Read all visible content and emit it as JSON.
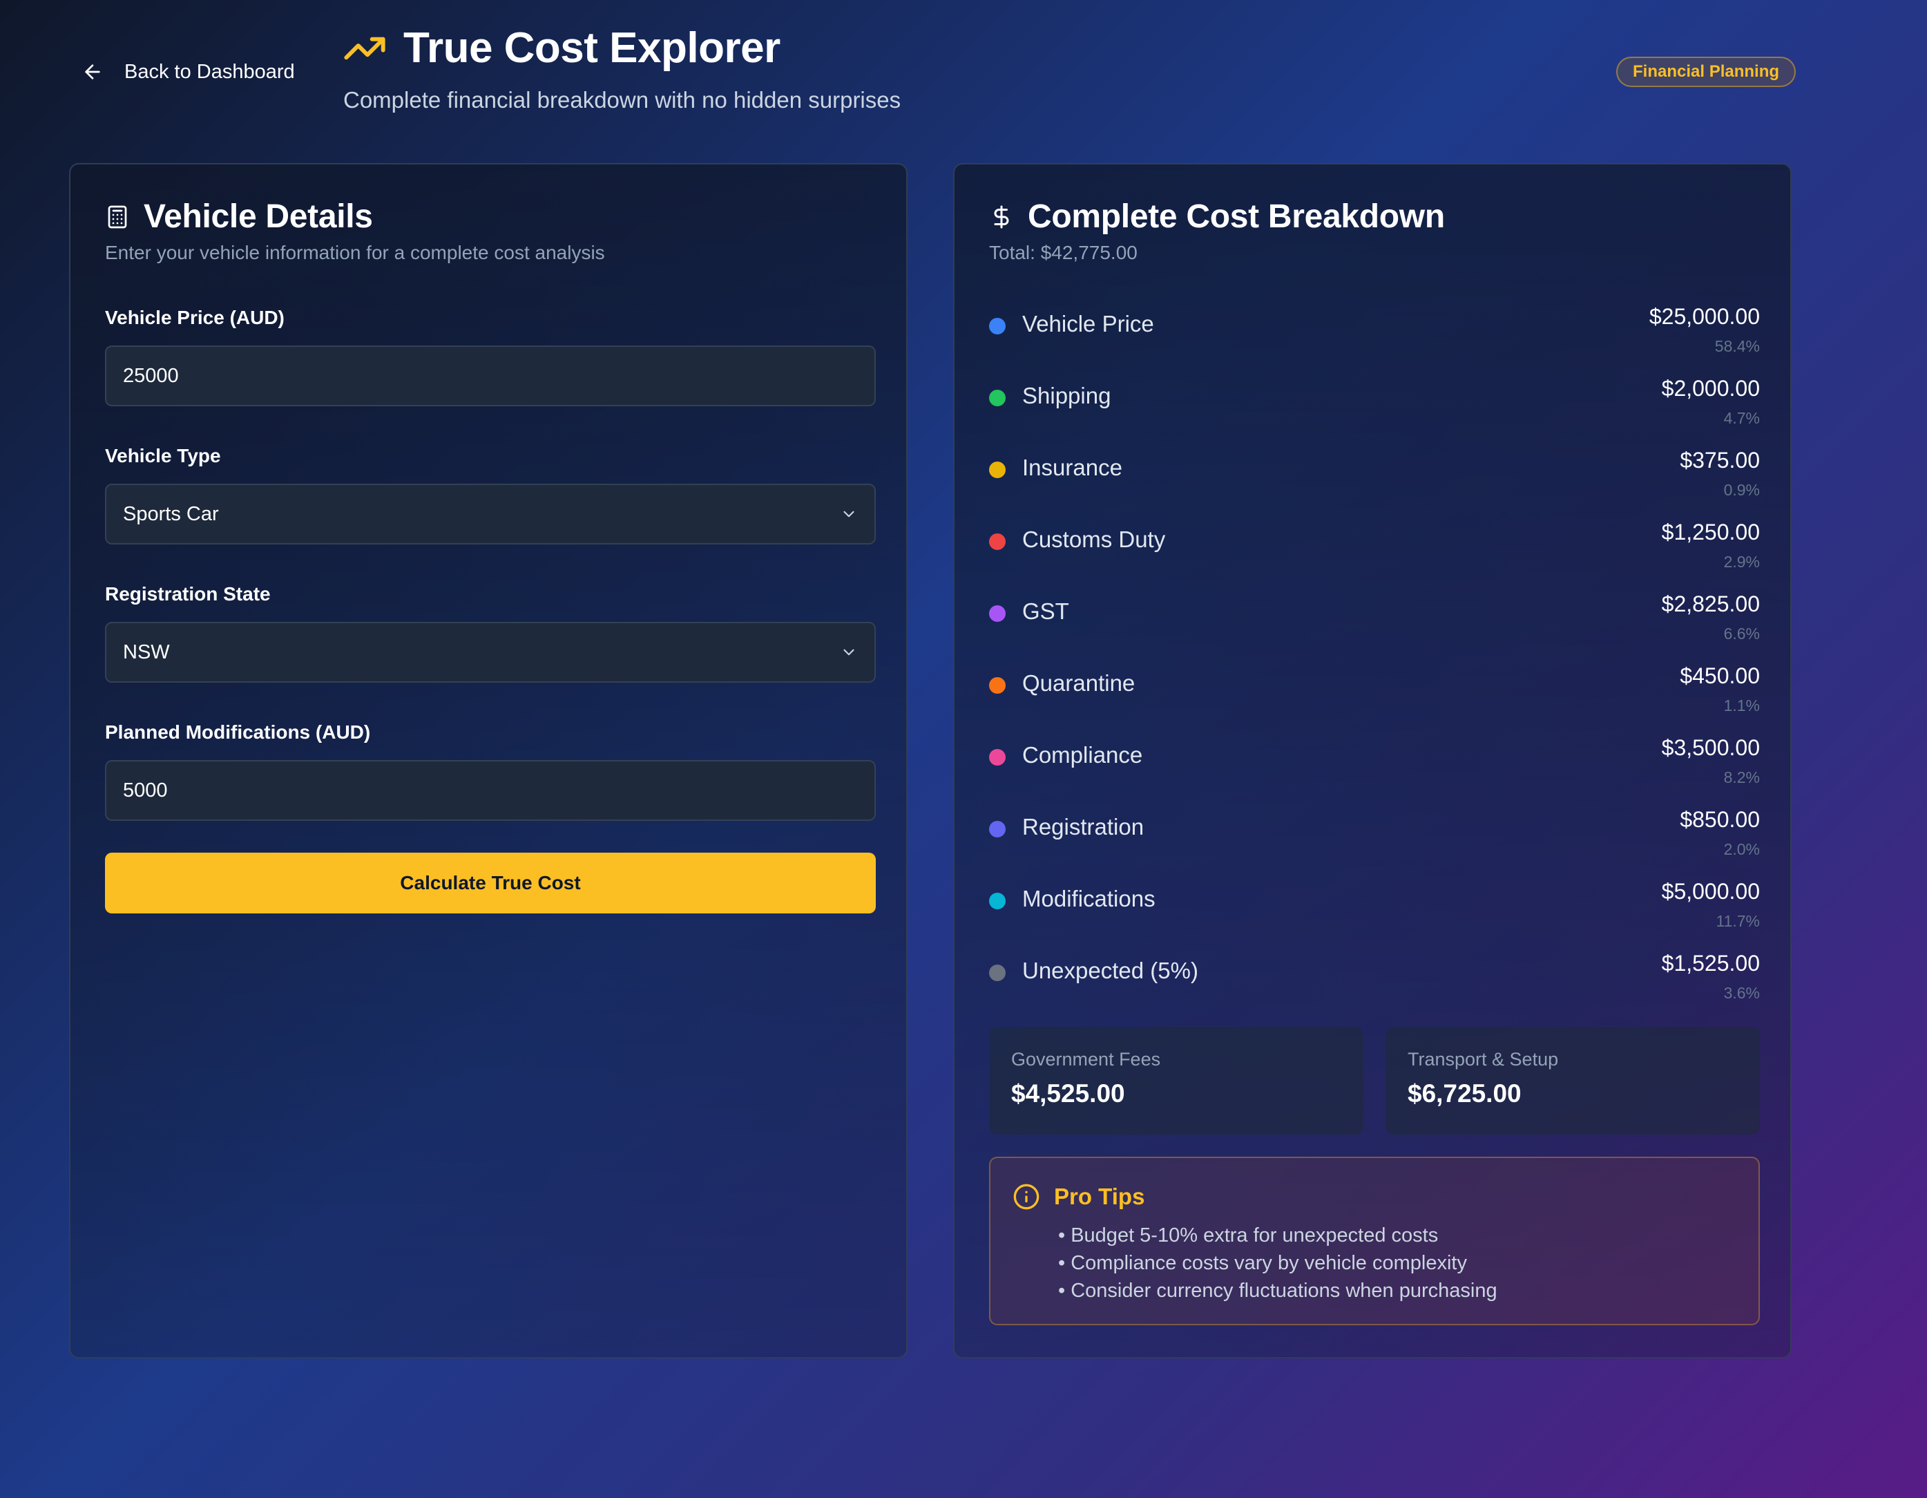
{
  "header": {
    "back_label": "Back to Dashboard",
    "title": "True Cost Explorer",
    "subtitle": "Complete financial breakdown with no hidden surprises",
    "badge": "Financial Planning"
  },
  "form": {
    "title": "Vehicle Details",
    "subtitle": "Enter your vehicle information for a complete cost analysis",
    "price_label": "Vehicle Price (AUD)",
    "price_value": "25000",
    "type_label": "Vehicle Type",
    "type_value": "Sports Car",
    "state_label": "Registration State",
    "state_value": "NSW",
    "mods_label": "Planned Modifications (AUD)",
    "mods_value": "5000",
    "button_label": "Calculate True Cost"
  },
  "breakdown": {
    "title": "Complete Cost Breakdown",
    "total": "Total: $42,775.00",
    "items": [
      {
        "label": "Vehicle Price",
        "amount": "$25,000.00",
        "pct": "58.4%",
        "color": "#3b82f6"
      },
      {
        "label": "Shipping",
        "amount": "$2,000.00",
        "pct": "4.7%",
        "color": "#22c55e"
      },
      {
        "label": "Insurance",
        "amount": "$375.00",
        "pct": "0.9%",
        "color": "#eab308"
      },
      {
        "label": "Customs Duty",
        "amount": "$1,250.00",
        "pct": "2.9%",
        "color": "#ef4444"
      },
      {
        "label": "GST",
        "amount": "$2,825.00",
        "pct": "6.6%",
        "color": "#a855f7"
      },
      {
        "label": "Quarantine",
        "amount": "$450.00",
        "pct": "1.1%",
        "color": "#f97316"
      },
      {
        "label": "Compliance",
        "amount": "$3,500.00",
        "pct": "8.2%",
        "color": "#ec4899"
      },
      {
        "label": "Registration",
        "amount": "$850.00",
        "pct": "2.0%",
        "color": "#6366f1"
      },
      {
        "label": "Modifications",
        "amount": "$5,000.00",
        "pct": "11.7%",
        "color": "#06b6d4"
      },
      {
        "label": "Unexpected (5%)",
        "amount": "$1,525.00",
        "pct": "3.6%",
        "color": "#6b7280"
      }
    ],
    "summary": [
      {
        "label": "Government Fees",
        "value": "$4,525.00"
      },
      {
        "label": "Transport & Setup",
        "value": "$6,725.00"
      }
    ]
  },
  "tips": {
    "title": "Pro Tips",
    "items": [
      "• Budget 5-10% extra for unexpected costs",
      "• Compliance costs vary by vehicle complexity",
      "• Consider currency fluctuations when purchasing"
    ]
  },
  "icons": {
    "back": "arrow-left-icon",
    "title": "trending-up-icon",
    "form": "calculator-icon",
    "breakdown": "dollar-sign-icon",
    "select": "chevron-down-icon",
    "tips": "info-icon"
  },
  "colors": {
    "accent": "#fbbf24",
    "input_bg": "#1e293b"
  }
}
